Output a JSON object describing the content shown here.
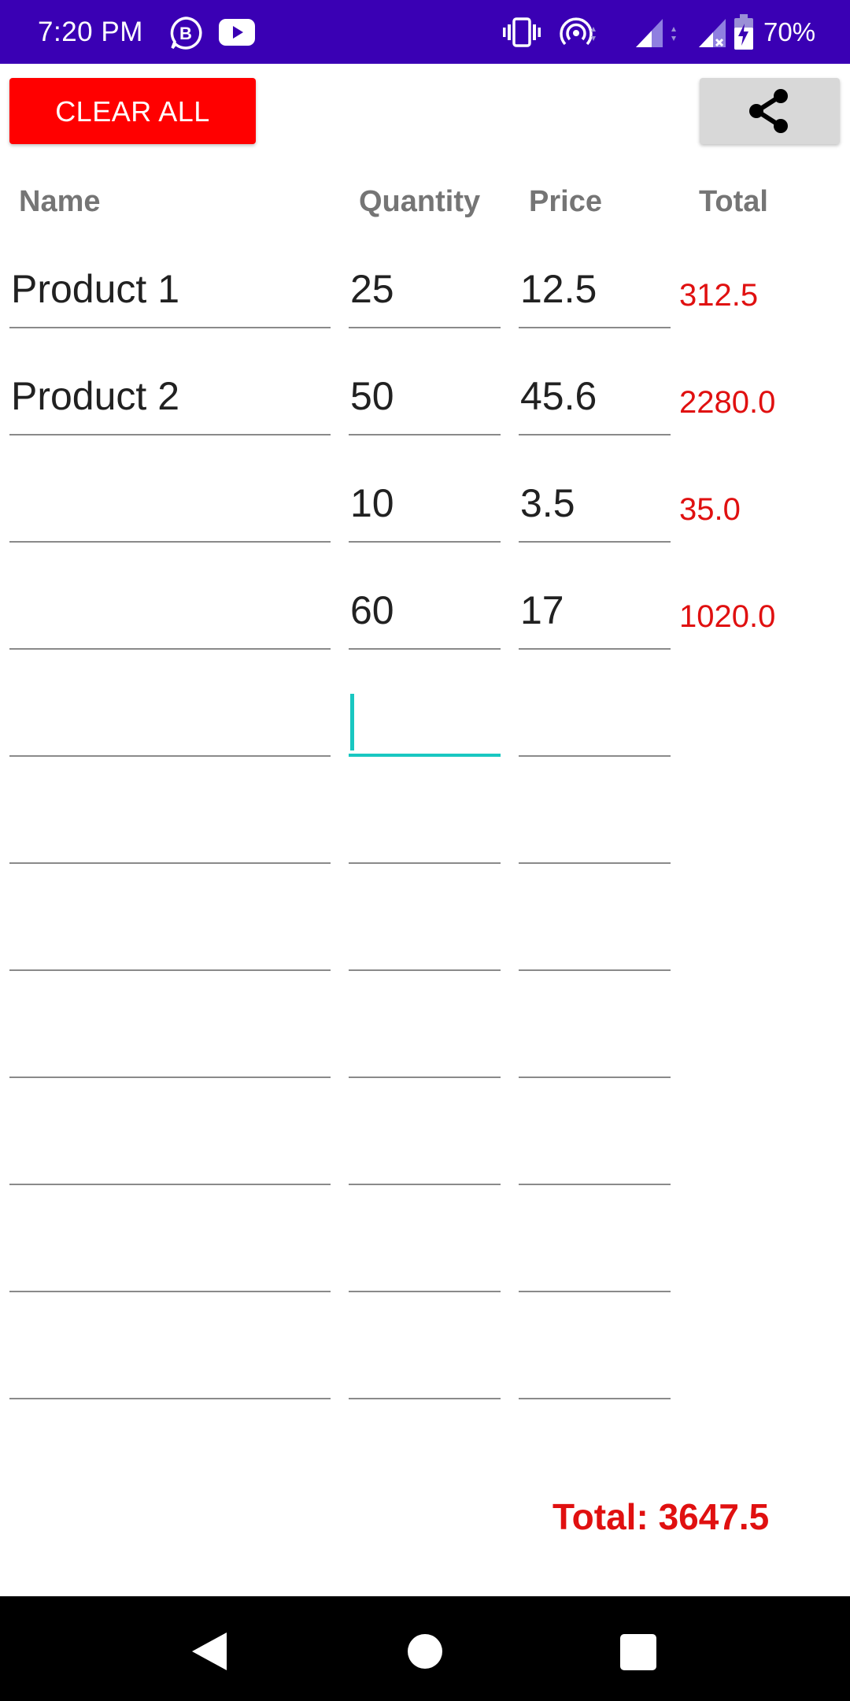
{
  "status_bar": {
    "time": "7:20 PM",
    "battery": "70%",
    "icons": [
      "business-b-icon",
      "youtube-icon",
      "vibrate-icon",
      "hotspot-icon",
      "signal-icon",
      "signal-no-data-icon",
      "battery-charging-icon"
    ]
  },
  "toolbar": {
    "clear_label": "CLEAR ALL",
    "share_icon": "share-icon"
  },
  "headers": {
    "name": "Name",
    "quantity": "Quantity",
    "price": "Price",
    "total": "Total"
  },
  "rows": [
    {
      "name": "Product 1",
      "quantity": "25",
      "price": "12.5",
      "total": "312.5"
    },
    {
      "name": "Product 2",
      "quantity": "50",
      "price": "45.6",
      "total": "2280.0"
    },
    {
      "name": "",
      "quantity": "10",
      "price": "3.5",
      "total": "35.0"
    },
    {
      "name": "",
      "quantity": "60",
      "price": "17",
      "total": "1020.0"
    },
    {
      "name": "",
      "quantity": "",
      "price": "",
      "total": ""
    },
    {
      "name": "",
      "quantity": "",
      "price": "",
      "total": ""
    },
    {
      "name": "",
      "quantity": "",
      "price": "",
      "total": ""
    },
    {
      "name": "",
      "quantity": "",
      "price": "",
      "total": ""
    },
    {
      "name": "",
      "quantity": "",
      "price": "",
      "total": ""
    },
    {
      "name": "",
      "quantity": "",
      "price": "",
      "total": ""
    },
    {
      "name": "",
      "quantity": "",
      "price": "",
      "total": ""
    }
  ],
  "grand_total": "Total: 3647.5",
  "colors": {
    "status_bar": "#3a00b4",
    "clear_button": "#ff0000",
    "total_text": "#e01010",
    "focus_accent": "#19c7c1"
  },
  "nav": {
    "back_icon": "back-icon",
    "home_icon": "home-icon",
    "recents_icon": "recents-icon"
  }
}
